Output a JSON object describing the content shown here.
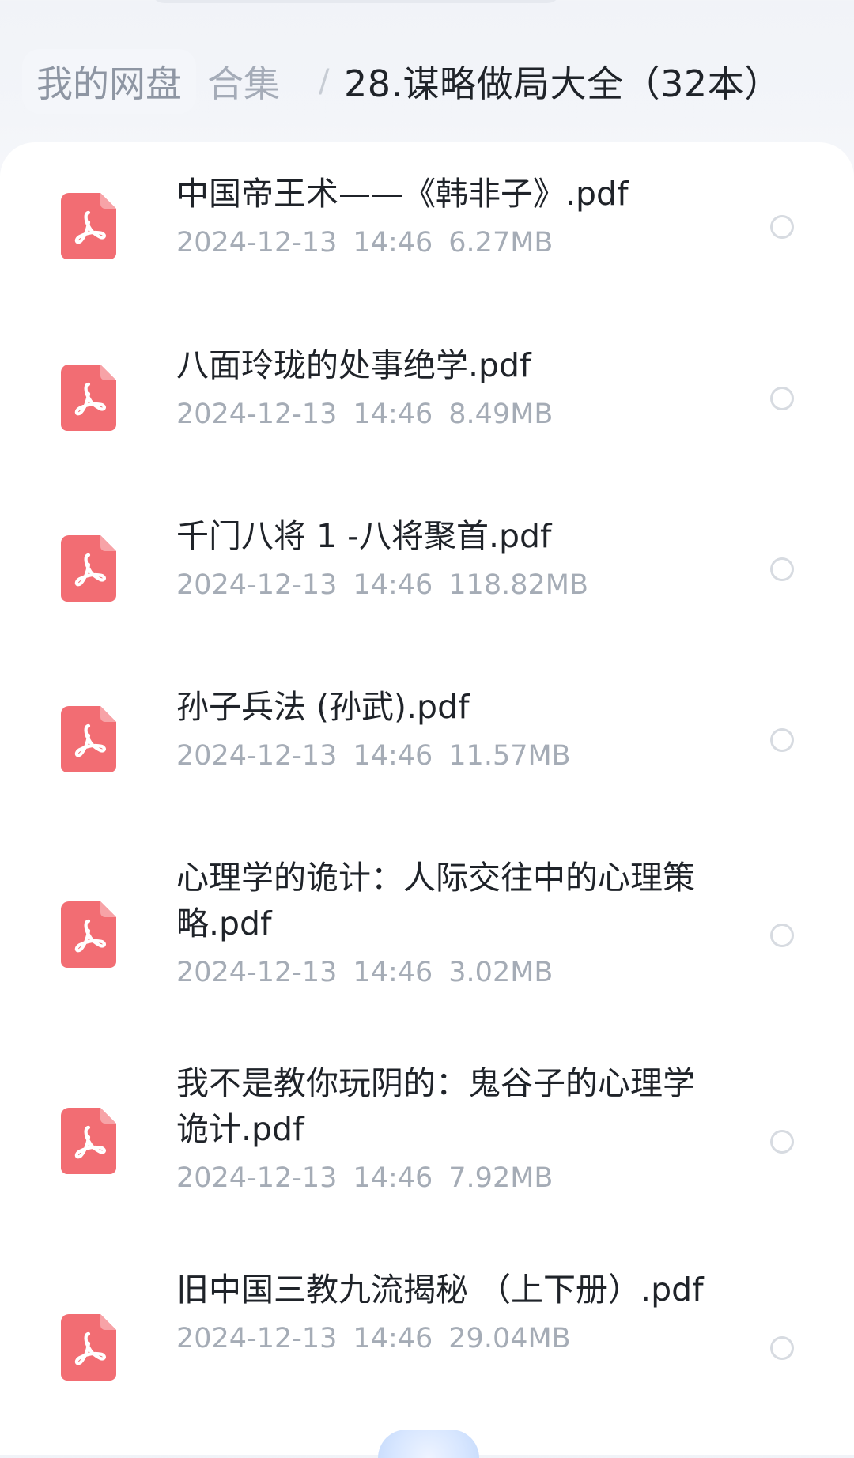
{
  "breadcrumb": {
    "root": "我的网盘",
    "middle": "合集",
    "separator": "/",
    "current": "28.谋略做局大全（32本）"
  },
  "files": [
    {
      "name": "中国帝王术——《韩非子》.pdf",
      "date": "2024-12-13",
      "time": "14:46",
      "size": "6.27MB"
    },
    {
      "name": "八面玲珑的处事绝学.pdf",
      "date": "2024-12-13",
      "time": "14:46",
      "size": "8.49MB"
    },
    {
      "name": "千门八将 1 -八将聚首.pdf",
      "date": "2024-12-13",
      "time": "14:46",
      "size": "118.82MB"
    },
    {
      "name": "孙子兵法 (孙武).pdf",
      "date": "2024-12-13",
      "time": "14:46",
      "size": "11.57MB"
    },
    {
      "name": "心理学的诡计：人际交往中的心理策略.pdf",
      "date": "2024-12-13",
      "time": "14:46",
      "size": "3.02MB"
    },
    {
      "name": "我不是教你玩阴的：鬼谷子的心理学诡计.pdf",
      "date": "2024-12-13",
      "time": "14:46",
      "size": "7.92MB"
    },
    {
      "name": "旧中国三教九流揭秘 （上下册）.pdf",
      "date": "2024-12-13",
      "time": "14:46",
      "size": "29.04MB"
    }
  ],
  "colors": {
    "pdf_icon": "#f26d73",
    "text_primary": "#1f2329",
    "text_secondary": "#a5acb6",
    "radio_border": "#d7dbe1"
  },
  "icons": {
    "file": "pdf-icon",
    "select": "radio-icon"
  }
}
